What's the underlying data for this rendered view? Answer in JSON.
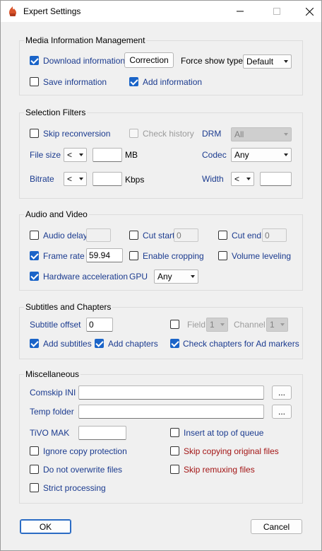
{
  "window": {
    "title": "Expert Settings"
  },
  "media": {
    "title": "Media Information Management",
    "download_info": {
      "label": "Download information",
      "checked": true
    },
    "correction_button": "Correction",
    "force_show_type_label": "Force show type",
    "force_show_type_value": "Default",
    "save_info": {
      "label": "Save information",
      "checked": false
    },
    "add_info": {
      "label": "Add information",
      "checked": true
    }
  },
  "selection": {
    "title": "Selection Filters",
    "skip_reconversion": {
      "label": "Skip reconversion",
      "checked": false
    },
    "check_history": {
      "label": "Check history",
      "checked": false,
      "disabled": true
    },
    "drm_label": "DRM",
    "drm_value": "All",
    "file_size_label": "File size",
    "file_size_op": "<",
    "file_size_value": "",
    "file_size_unit": "MB",
    "codec_label": "Codec",
    "codec_value": "Any",
    "bitrate_label": "Bitrate",
    "bitrate_op": "<",
    "bitrate_value": "",
    "bitrate_unit": "Kbps",
    "width_label": "Width",
    "width_op": "<",
    "width_value": ""
  },
  "av": {
    "title": "Audio and Video",
    "audio_delay": {
      "label": "Audio delay",
      "checked": false,
      "value": ""
    },
    "cut_start": {
      "label": "Cut start",
      "checked": false,
      "value": "0"
    },
    "cut_end": {
      "label": "Cut end",
      "checked": false,
      "value": "0"
    },
    "frame_rate": {
      "label": "Frame rate",
      "checked": true,
      "value": "59.94"
    },
    "enable_cropping": {
      "label": "Enable cropping",
      "checked": false
    },
    "volume_leveling": {
      "label": "Volume leveling",
      "checked": false
    },
    "hw_accel": {
      "label": "Hardware acceleration",
      "checked": true
    },
    "gpu_label": "GPU",
    "gpu_value": "Any"
  },
  "subs": {
    "title": "Subtitles and Chapters",
    "subtitle_offset_label": "Subtitle offset",
    "subtitle_offset_value": "0",
    "field": {
      "checked": false,
      "label": "Field",
      "value": "1"
    },
    "channel_label": "Channel",
    "channel_value": "1",
    "add_subtitles": {
      "label": "Add subtitles",
      "checked": true
    },
    "add_chapters": {
      "label": "Add chapters",
      "checked": true
    },
    "check_chapters_ads": {
      "label": "Check chapters for Ad markers",
      "checked": true
    }
  },
  "misc": {
    "title": "Miscellaneous",
    "comskip_label": "Comskip INI",
    "comskip_value": "",
    "browse_label": "...",
    "temp_folder_label": "Temp folder",
    "temp_folder_value": "",
    "tivo_mak_label": "TiVO MAK",
    "tivo_mak_value": "",
    "insert_top": {
      "label": "Insert at top of queue",
      "checked": false
    },
    "ignore_copy": {
      "label": "Ignore copy protection",
      "checked": false
    },
    "skip_copy_orig": {
      "label": "Skip copying original files",
      "checked": false
    },
    "no_overwrite": {
      "label": "Do not overwrite files",
      "checked": false
    },
    "skip_remux": {
      "label": "Skip remuxing files",
      "checked": false
    },
    "strict": {
      "label": "Strict processing",
      "checked": false
    }
  },
  "footer": {
    "ok_label": "OK",
    "cancel_label": "Cancel"
  },
  "colors": {
    "accent": "#1a64c8",
    "blue_label": "#1b3b8f",
    "red_label": "#a31515"
  },
  "icons": {
    "app": "app-flame-icon",
    "minimize": "minimize-icon",
    "maximize": "maximize-icon",
    "close": "close-icon"
  }
}
